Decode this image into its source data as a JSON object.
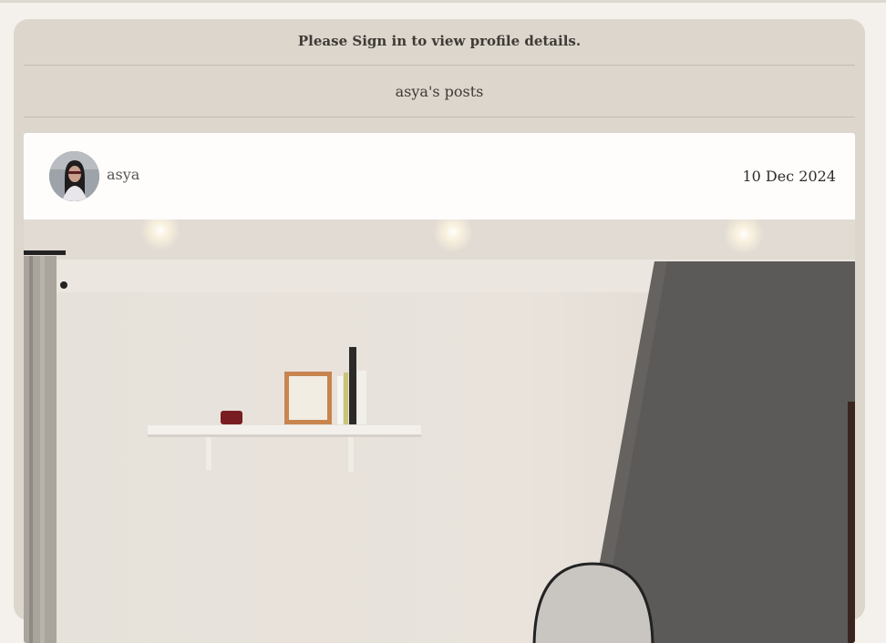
{
  "notice": {
    "text": "Please Sign in to view profile details."
  },
  "posts_section": {
    "heading": "asya's posts"
  },
  "post": {
    "author": "asya",
    "date": "10 Dec 2024",
    "avatar_icon": "user-avatar",
    "image_icon": "room-interior-photo"
  },
  "colors": {
    "page_bg": "#f4f1ec",
    "panel_bg": "#ddd6cd",
    "card_bg": "#fefdfc",
    "text": "#3e3a35"
  }
}
